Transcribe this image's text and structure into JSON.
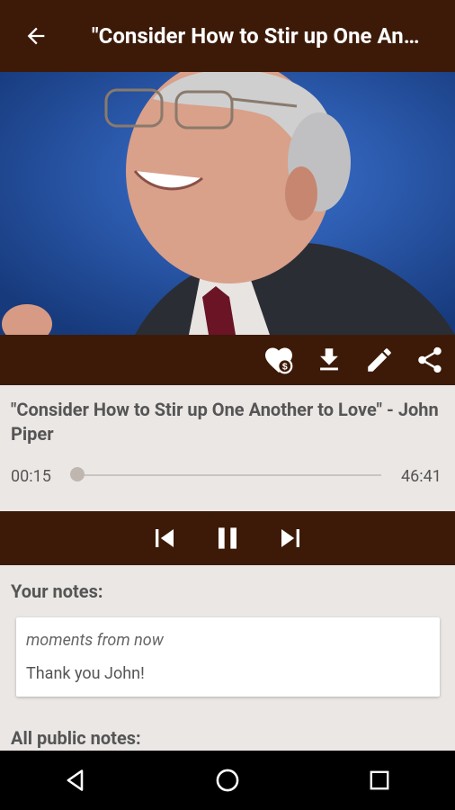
{
  "header": {
    "title": "\"Consider How to Stir up One Another to Love\" - John Piper",
    "back_icon": "arrow-back-icon"
  },
  "hero": {
    "alt": "Speaker photo"
  },
  "actions": [
    {
      "name": "favorite-sermon-icon"
    },
    {
      "name": "download-icon"
    },
    {
      "name": "edit-icon"
    },
    {
      "name": "share-icon"
    }
  ],
  "sermon": {
    "title": "\"Consider How to Stir up One Another to Love\" - John Piper",
    "elapsed": "00:15",
    "duration": "46:41",
    "progress_fraction": 0.005
  },
  "player": {
    "previous": "skip-previous-icon",
    "pause": "pause-icon",
    "next": "skip-next-icon"
  },
  "notes": {
    "your_label": "Your notes:",
    "items": [
      {
        "time": "moments from now",
        "text": "Thank you John!"
      }
    ],
    "public_label": "All public notes:"
  },
  "colors": {
    "brand": "#3d1a08",
    "background": "#ebe7e5"
  }
}
